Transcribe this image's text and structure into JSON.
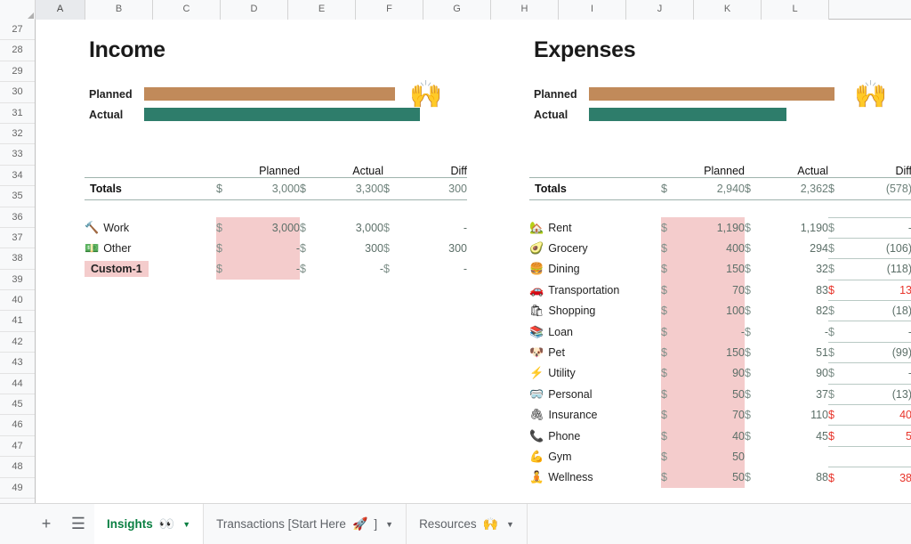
{
  "grid": {
    "columns": [
      "A",
      "B",
      "C",
      "D",
      "E",
      "F",
      "G",
      "H",
      "I",
      "J",
      "K",
      "L"
    ],
    "selected_column": "A",
    "rows": [
      "27",
      "28",
      "29",
      "30",
      "31",
      "32",
      "33",
      "34",
      "35",
      "36",
      "37",
      "38",
      "39",
      "40",
      "41",
      "42",
      "43",
      "44",
      "45",
      "46",
      "47",
      "48",
      "49"
    ]
  },
  "colors": {
    "planned_bar": "#c18a5a",
    "actual_bar": "#2e7d6b",
    "input_fill": "#f4cccc",
    "over_budget": "#e8342a",
    "muted_text": "#5c6f68",
    "active_tab": "#0b8043"
  },
  "income": {
    "title": "Income",
    "chart": {
      "planned_label": "Planned",
      "actual_label": "Actual",
      "emoji": "raising-hands"
    },
    "headers": {
      "planned": "Planned",
      "actual": "Actual",
      "diff": "Diff"
    },
    "totals": {
      "label": "Totals",
      "planned": "3,000",
      "actual": "3,300",
      "diff": "300",
      "currency": "$"
    },
    "rows": [
      {
        "emoji": "hammer",
        "name": "Work",
        "custom": false,
        "planned": "3,000",
        "actual": "3,000",
        "diff": "-",
        "diff_over": false
      },
      {
        "emoji": "money",
        "name": "Other",
        "custom": false,
        "planned": "-",
        "actual": "300",
        "diff": "300",
        "diff_over": false
      },
      {
        "emoji": "",
        "name": "Custom-1",
        "custom": true,
        "planned": "-",
        "actual": "-",
        "diff": "-",
        "diff_over": false
      }
    ]
  },
  "expenses": {
    "title": "Expenses",
    "chart": {
      "planned_label": "Planned",
      "actual_label": "Actual",
      "emoji": "raising-hands"
    },
    "headers": {
      "planned": "Planned",
      "actual": "Actual",
      "diff": "Diff"
    },
    "totals": {
      "label": "Totals",
      "planned": "2,940",
      "actual": "2,362",
      "diff": "(578)",
      "currency": "$"
    },
    "rows": [
      {
        "emoji": "house",
        "name": "Rent",
        "planned": "1,190",
        "actual": "1,190",
        "diff": "-",
        "diff_over": false
      },
      {
        "emoji": "avocado",
        "name": "Grocery",
        "planned": "400",
        "actual": "294",
        "diff": "(106)",
        "diff_over": false
      },
      {
        "emoji": "hamburger",
        "name": "Dining",
        "planned": "150",
        "actual": "32",
        "diff": "(118)",
        "diff_over": false
      },
      {
        "emoji": "car",
        "name": "Transportation",
        "planned": "70",
        "actual": "83",
        "diff": "13",
        "diff_over": true
      },
      {
        "emoji": "shopping",
        "name": "Shopping",
        "planned": "100",
        "actual": "82",
        "diff": "(18)",
        "diff_over": false
      },
      {
        "emoji": "books",
        "name": "Loan",
        "planned": "-",
        "actual": "-",
        "diff": "-",
        "diff_over": false
      },
      {
        "emoji": "dog",
        "name": "Pet",
        "planned": "150",
        "actual": "51",
        "diff": "(99)",
        "diff_over": false
      },
      {
        "emoji": "bolt",
        "name": "Utility",
        "planned": "90",
        "actual": "90",
        "diff": "-",
        "diff_over": false
      },
      {
        "emoji": "mask",
        "name": "Personal",
        "planned": "50",
        "actual": "37",
        "diff": "(13)",
        "diff_over": false
      },
      {
        "emoji": "paperclip",
        "name": "Insurance",
        "planned": "70",
        "actual": "110",
        "diff": "40",
        "diff_over": true
      },
      {
        "emoji": "phone",
        "name": "Phone",
        "planned": "40",
        "actual": "45",
        "diff": "5",
        "diff_over": true
      },
      {
        "emoji": "muscle",
        "name": "Gym",
        "planned": "50",
        "actual": "",
        "diff": "",
        "diff_over": false
      },
      {
        "emoji": "lotus",
        "name": "Wellness",
        "planned": "50",
        "actual": "88",
        "diff": "38",
        "diff_over": true
      }
    ]
  },
  "chart_data": [
    {
      "type": "bar",
      "title": "Income",
      "categories": [
        "Planned",
        "Actual"
      ],
      "values": [
        3000,
        3300
      ],
      "orientation": "horizontal",
      "series_colors": [
        "#c18a5a",
        "#2e7d6b"
      ],
      "xlabel": "",
      "ylabel": "",
      "grid": false,
      "legend": "none"
    },
    {
      "type": "bar",
      "title": "Expenses",
      "categories": [
        "Planned",
        "Actual"
      ],
      "values": [
        2940,
        2362
      ],
      "orientation": "horizontal",
      "series_colors": [
        "#c18a5a",
        "#2e7d6b"
      ],
      "xlabel": "",
      "ylabel": "",
      "grid": false,
      "legend": "none"
    }
  ],
  "tabbar": {
    "add_label": "+",
    "list_label": "☰",
    "tabs": [
      {
        "label": "Insights",
        "emoji": "eyes",
        "active": true
      },
      {
        "label": "Transactions [Start Here",
        "emoji": "rocket",
        "suffix": "]",
        "active": false
      },
      {
        "label": "Resources",
        "emoji": "raising-hands",
        "active": false
      }
    ]
  }
}
